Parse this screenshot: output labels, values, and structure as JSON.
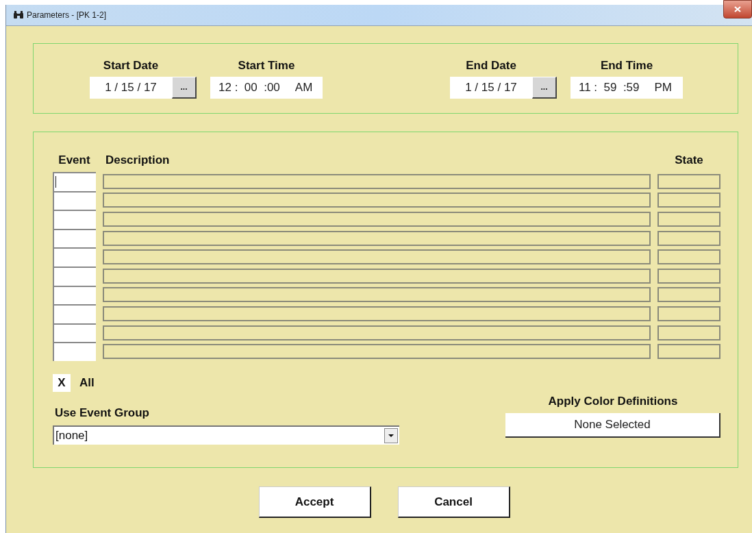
{
  "window": {
    "title": "Parameters - [PK 1-2]"
  },
  "range": [
    {
      "date_label": "Start Date",
      "date": "1 / 15 / 17",
      "picker": "...",
      "time_label": "Start Time",
      "time": "12 :  00  :00",
      "ampm": "AM"
    },
    {
      "date_label": "End Date",
      "date": "1 / 15 / 17",
      "picker": "...",
      "time_label": "End Time",
      "time": "11 :  59  :59",
      "ampm": "PM"
    }
  ],
  "events": {
    "columns": [
      "Event",
      "Description",
      "State"
    ],
    "rows": [
      {
        "focused": true
      },
      {
        "focused": false
      },
      {
        "focused": false
      },
      {
        "focused": false
      },
      {
        "focused": false
      },
      {
        "focused": false
      },
      {
        "focused": false
      },
      {
        "focused": false
      },
      {
        "focused": false
      },
      {
        "focused": false
      }
    ]
  },
  "all_checkbox": {
    "label": "All",
    "checked": true,
    "mark": "X"
  },
  "event_group": {
    "label": "Use Event Group",
    "value": "[none]"
  },
  "color_definitions": {
    "label": "Apply Color Definitions",
    "value": "None Selected"
  },
  "buttons": [
    "Accept",
    "Cancel"
  ]
}
